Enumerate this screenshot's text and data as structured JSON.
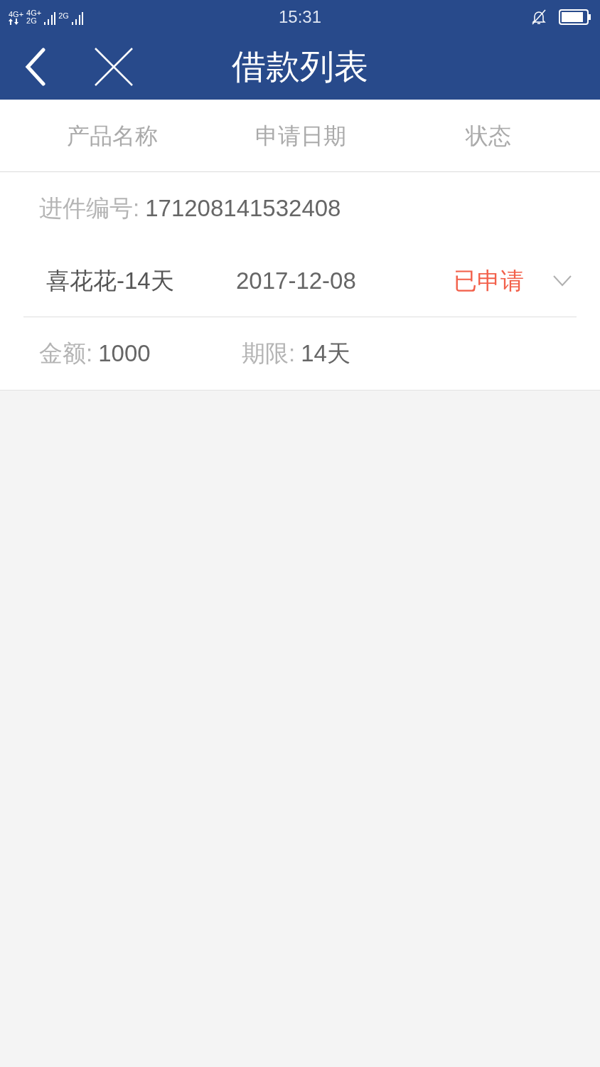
{
  "status_bar": {
    "network_labels": [
      "4G+",
      "4G+",
      "2G",
      "2G"
    ],
    "time": "15:31"
  },
  "nav_bar": {
    "title": "借款列表"
  },
  "columns": [
    "产品名称",
    "申请日期",
    "状态"
  ],
  "loans": [
    {
      "id_label": "进件编号:",
      "id_value": "171208141532408",
      "product": "喜花花-14天",
      "date": "2017-12-08",
      "status": "已申请",
      "amount_label": "金额:",
      "amount": "1000",
      "term_label": "期限:",
      "term": "14天"
    }
  ]
}
